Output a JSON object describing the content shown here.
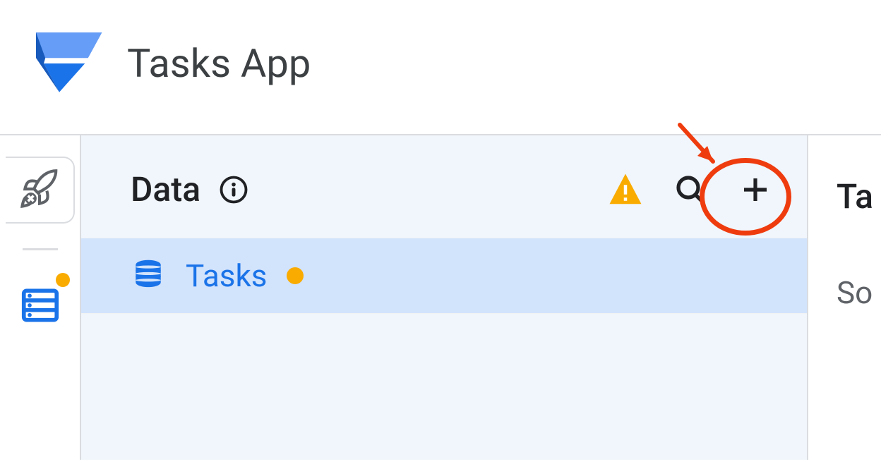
{
  "header": {
    "app_title": "Tasks App"
  },
  "middle_panel": {
    "title": "Data",
    "items": [
      {
        "label": "Tasks",
        "has_status_dot": true
      }
    ]
  },
  "right_panel": {
    "title_fragment": "Ta",
    "sub_fragment": "So"
  },
  "icons": {
    "logo": "appsheet-logo-icon",
    "rocket": "rocket-icon",
    "database": "database-icon",
    "info": "info-icon",
    "warning": "warning-triangle-icon",
    "search": "search-icon",
    "plus": "plus-icon"
  },
  "colors": {
    "accent_blue": "#1a73e8",
    "selection_bg": "#d2e3fc",
    "panel_bg": "#f1f6fc",
    "warning_orange": "#f9ab00",
    "annotation_red": "#ef3c0f"
  }
}
